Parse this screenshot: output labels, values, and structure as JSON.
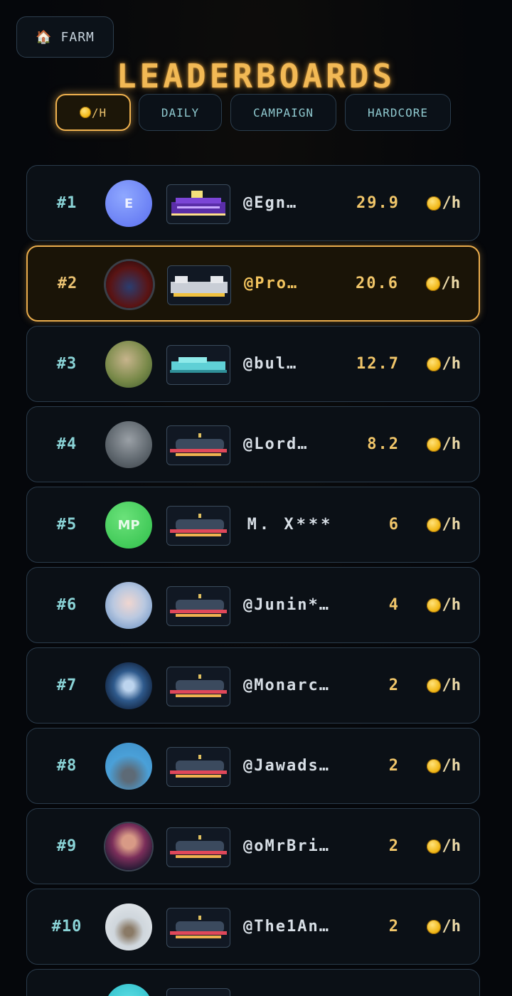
{
  "nav": {
    "farm_icon": "house-icon",
    "farm_label": "FARM"
  },
  "title": "LEADERBOARDS",
  "tabs": [
    {
      "label": "/H",
      "icon": "coin-icon",
      "active": true
    },
    {
      "label": "DAILY",
      "active": false
    },
    {
      "label": "CAMPAIGN",
      "active": false
    },
    {
      "label": "HARDCORE",
      "active": false
    }
  ],
  "rate_unit": "/h",
  "rows": [
    {
      "rank": "#1",
      "avatar_text": "E",
      "name": "@Egn…",
      "score": "29.9"
    },
    {
      "rank": "#2",
      "avatar_text": "",
      "name": "@Pro…",
      "score": "20.6",
      "highlight": true
    },
    {
      "rank": "#3",
      "avatar_text": "",
      "name": "@bul…",
      "score": "12.7"
    },
    {
      "rank": "#4",
      "avatar_text": "",
      "name": "@Lord…",
      "score": "8.2"
    },
    {
      "rank": "#5",
      "avatar_text": "MP",
      "name": "M. X***",
      "score": "6"
    },
    {
      "rank": "#6",
      "avatar_text": "",
      "name": "@Junin*…",
      "score": "4"
    },
    {
      "rank": "#7",
      "avatar_text": "",
      "name": "@Monarc…",
      "score": "2"
    },
    {
      "rank": "#8",
      "avatar_text": "",
      "name": "@Jawads…",
      "score": "2"
    },
    {
      "rank": "#9",
      "avatar_text": "",
      "name": "@oMrBri…",
      "score": "2"
    },
    {
      "rank": "#10",
      "avatar_text": "",
      "name": "@The1An…",
      "score": "2"
    }
  ],
  "colors": {
    "accent": "#f0b24f",
    "rank": "#8ad3d6",
    "score": "#f1c66a",
    "background": "#05070b"
  }
}
